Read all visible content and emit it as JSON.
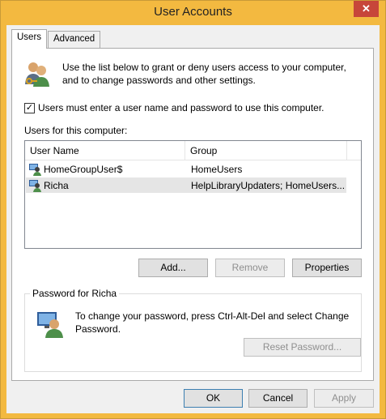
{
  "window": {
    "title": "User Accounts",
    "close_glyph": "✕"
  },
  "tabs": [
    {
      "label": "Users",
      "active": true
    },
    {
      "label": "Advanced",
      "active": false
    }
  ],
  "users_tab": {
    "intro": "Use the list below to grant or deny users access to your computer, and to change passwords and other settings.",
    "require_login": {
      "label": "Users must enter a user name and password to use this computer.",
      "checked": true,
      "glyph": "✓"
    },
    "list_caption": "Users for this computer:",
    "columns": [
      "User Name",
      "Group"
    ],
    "rows": [
      {
        "name": "HomeGroupUser$",
        "group": "HomeUsers",
        "icon": "user-account-icon"
      },
      {
        "name": "Richa",
        "group": "HelpLibraryUpdaters; HomeUsers...",
        "icon": "user-account-icon",
        "selected": true
      }
    ],
    "buttons": {
      "add": "Add...",
      "remove": "Remove",
      "properties": "Properties"
    },
    "password_group": {
      "title": "Password for Richa",
      "text": "To change your password, press Ctrl-Alt-Del and select Change Password.",
      "reset_button": "Reset Password..."
    }
  },
  "dialog_buttons": {
    "ok": "OK",
    "cancel": "Cancel",
    "apply": "Apply"
  },
  "colors": {
    "titlebar": "#f3b940",
    "close": "#c7463a",
    "selection": "#e5e5e5"
  }
}
